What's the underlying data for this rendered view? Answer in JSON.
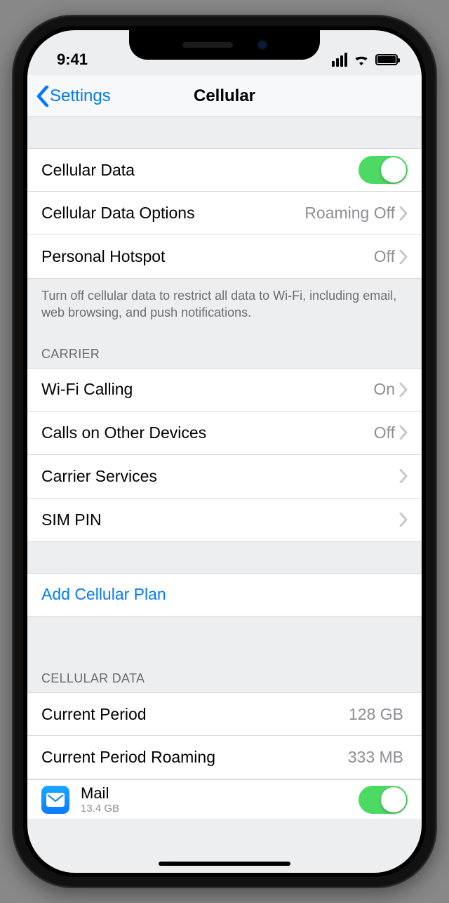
{
  "status": {
    "time": "9:41"
  },
  "nav": {
    "back_label": "Settings",
    "title": "Cellular"
  },
  "section1": {
    "cellular_data": {
      "label": "Cellular Data",
      "on": true
    },
    "data_options": {
      "label": "Cellular Data Options",
      "detail": "Roaming Off"
    },
    "hotspot": {
      "label": "Personal Hotspot",
      "detail": "Off"
    },
    "footer": "Turn off cellular data to restrict all data to Wi-Fi, including email, web browsing, and push notifications."
  },
  "section2": {
    "header": "CARRIER",
    "wifi_calling": {
      "label": "Wi-Fi Calling",
      "detail": "On"
    },
    "other_devices": {
      "label": "Calls on Other Devices",
      "detail": "Off"
    },
    "carrier_services": {
      "label": "Carrier Services"
    },
    "sim_pin": {
      "label": "SIM PIN"
    }
  },
  "section3": {
    "add_plan": "Add Cellular Plan"
  },
  "section4": {
    "header": "CELLULAR DATA",
    "current_period": {
      "label": "Current Period",
      "detail": "128 GB"
    },
    "roaming": {
      "label": "Current Period Roaming",
      "detail": "333 MB"
    },
    "mail": {
      "label": "Mail",
      "sub": "13.4 GB",
      "on": true
    }
  }
}
